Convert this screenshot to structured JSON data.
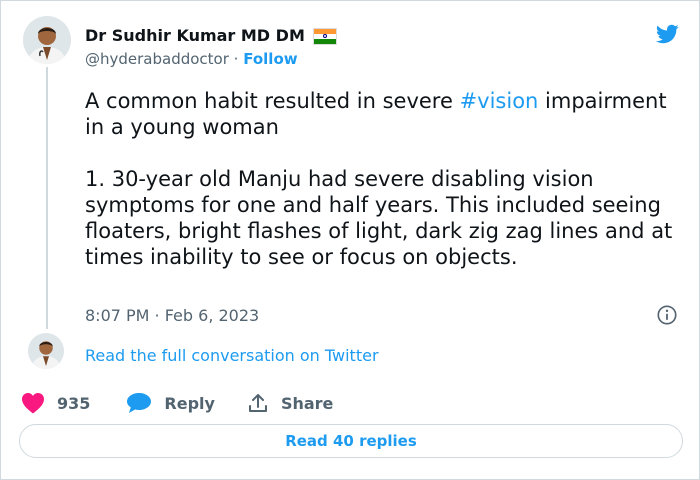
{
  "tweet": {
    "author_name": "Dr Sudhir Kumar MD DM",
    "author_handle": "@hyderabaddoctor",
    "separator": " · ",
    "follow_label": "Follow",
    "text_line1_pre": "A common habit resulted in severe ",
    "hashtag": "#vision",
    "text_line1_post": " impairment in a young woman",
    "text_para2": "1. 30-year old Manju had severe disabling vision symptoms for one and half years. This included seeing floaters, bright flashes of light, dark zig zag lines and at times inability to see or focus on objects.",
    "timestamp": "8:07 PM · Feb 6, 2023",
    "read_conversation_label": "Read the full conversation on Twitter"
  },
  "actions": {
    "like_count": "935",
    "reply_label": "Reply",
    "share_label": "Share"
  },
  "replies_button_label": "Read 40 replies",
  "icons": {
    "logo": "twitter-bird-icon",
    "flag": "india-flag-icon",
    "info": "info-icon",
    "like": "heart-icon",
    "reply": "speech-bubble-icon",
    "share": "share-upload-icon"
  },
  "colors": {
    "brand_blue": "#1d9bf0",
    "like_red": "#f91880",
    "text_primary": "#0f1419",
    "text_secondary": "#536471",
    "border": "#cfd9de"
  }
}
